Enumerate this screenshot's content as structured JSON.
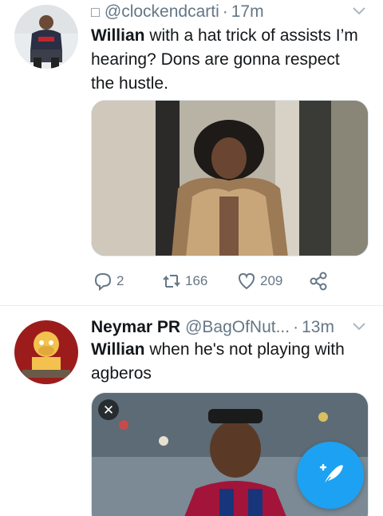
{
  "tweets": [
    {
      "glyph": "□",
      "handle": "@clockendcarti",
      "separator": "·",
      "time": "17m",
      "text_bold": "Willian",
      "text_line1_rest": " with a hat trick of assists I’m",
      "text_line2": "hearing? Dons are gonna respect",
      "text_line3": "the hustle.",
      "actions": {
        "replies": "2",
        "retweets": "166",
        "likes": "209"
      }
    },
    {
      "name": "Neymar PR",
      "handle": "@BagOfNut...",
      "separator": "·",
      "time": "13m",
      "text_bold": "Willian",
      "text_line1_rest": " when he's not playing with",
      "text_line2": "agberos",
      "close_label": "✕"
    }
  ],
  "icons": {
    "reply": "reply-icon",
    "retweet": "retweet-icon",
    "like": "heart-icon",
    "share": "share-icon",
    "more": "chevron-down-icon",
    "compose": "compose-tweet-icon"
  },
  "colors": {
    "accent": "#1da1f2",
    "text_primary": "#14171a",
    "text_secondary": "#657786",
    "divider": "#e6ecf0"
  }
}
